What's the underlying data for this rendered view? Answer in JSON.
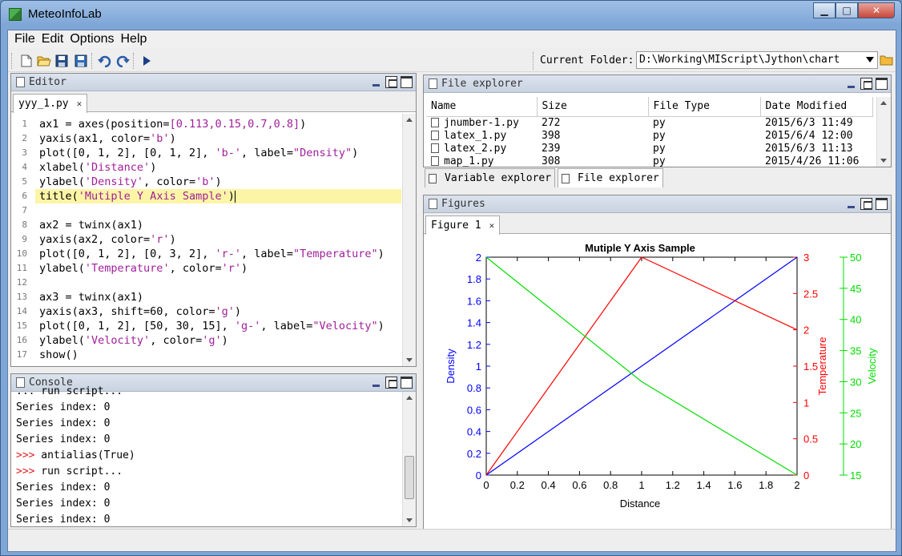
{
  "window": {
    "title": "MeteoInfoLab",
    "minimize": "▁",
    "maximize": "□",
    "close": "✕"
  },
  "menu": [
    "File",
    "Edit",
    "Options",
    "Help"
  ],
  "toolbar": {
    "buttons": [
      "new-file-icon",
      "open-file-icon",
      "save-icon",
      "save-all-icon",
      "undo-icon",
      "redo-icon",
      "run-icon"
    ],
    "current_folder_label": "Current Folder:",
    "current_folder": "D:\\Working\\MIScript\\Jython\\chart"
  },
  "editor": {
    "title": "Editor",
    "tab": "yyy_1.py",
    "lines": [
      "1",
      "2",
      "3",
      "4",
      "5",
      "6",
      "7",
      "8",
      "9",
      "10",
      "11",
      "12",
      "13",
      "14",
      "15",
      "16",
      "17"
    ]
  },
  "console": {
    "title": "Console",
    "lines": [
      {
        "prompt": "",
        "text": "... run script..."
      },
      {
        "prompt": "",
        "text": "Series index: 0"
      },
      {
        "prompt": "",
        "text": "Series index: 0"
      },
      {
        "prompt": "",
        "text": "Series index: 0"
      },
      {
        "prompt": ">>>",
        "text": " antialias(True)"
      },
      {
        "prompt": ">>>",
        "text": " run script..."
      },
      {
        "prompt": "",
        "text": "Series index: 0"
      },
      {
        "prompt": "",
        "text": "Series index: 0"
      },
      {
        "prompt": "",
        "text": "Series index: 0"
      }
    ]
  },
  "file_explorer": {
    "title": "File explorer",
    "columns": [
      "Name",
      "Size",
      "File Type",
      "Date Modified"
    ],
    "rows": [
      [
        "jnumber-1.py",
        "272",
        "py",
        "2015/6/3 11:49"
      ],
      [
        "latex_1.py",
        "398",
        "py",
        "2015/6/4 12:00"
      ],
      [
        "latex_2.py",
        "239",
        "py",
        "2015/6/3 11:13"
      ],
      [
        "map_1.py",
        "308",
        "py",
        "2015/4/26 11:06"
      ]
    ],
    "tabs": [
      "Variable explorer",
      "File explorer"
    ]
  },
  "figures": {
    "title": "Figures",
    "tab": "Figure 1"
  },
  "chart_data": {
    "type": "line",
    "title": "Mutiple Y Axis Sample",
    "xlabel": "Distance",
    "xlim": [
      0,
      2
    ],
    "xticks": [
      "0",
      "0.2",
      "0.4",
      "0.6",
      "0.8",
      "1",
      "1.2",
      "1.4",
      "1.6",
      "1.8",
      "2"
    ],
    "axes": [
      {
        "label": "Density",
        "color": "#0000ff",
        "ylim": [
          0,
          2
        ],
        "ticks": [
          "0",
          "0.2",
          "0.4",
          "0.6",
          "0.8",
          "1",
          "1.2",
          "1.4",
          "1.6",
          "1.8",
          "2"
        ]
      },
      {
        "label": "Temperature",
        "color": "#ff0000",
        "ylim": [
          0,
          3
        ],
        "ticks": [
          "0",
          "0.5",
          "1",
          "1.5",
          "2",
          "2.5",
          "3"
        ]
      },
      {
        "label": "Velocity",
        "color": "#00dd00",
        "ylim": [
          15,
          50
        ],
        "ticks": [
          "15",
          "20",
          "25",
          "30",
          "35",
          "40",
          "45",
          "50"
        ]
      }
    ],
    "series": [
      {
        "name": "Density",
        "axis": 0,
        "x": [
          0,
          1,
          2
        ],
        "y": [
          0,
          1,
          2
        ],
        "color": "#0000ff"
      },
      {
        "name": "Temperature",
        "axis": 1,
        "x": [
          0,
          1,
          2
        ],
        "y": [
          0,
          3,
          2
        ],
        "color": "#ff0000"
      },
      {
        "name": "Velocity",
        "axis": 2,
        "x": [
          0,
          1,
          2
        ],
        "y": [
          50,
          30,
          15
        ],
        "color": "#00dd00"
      }
    ]
  }
}
